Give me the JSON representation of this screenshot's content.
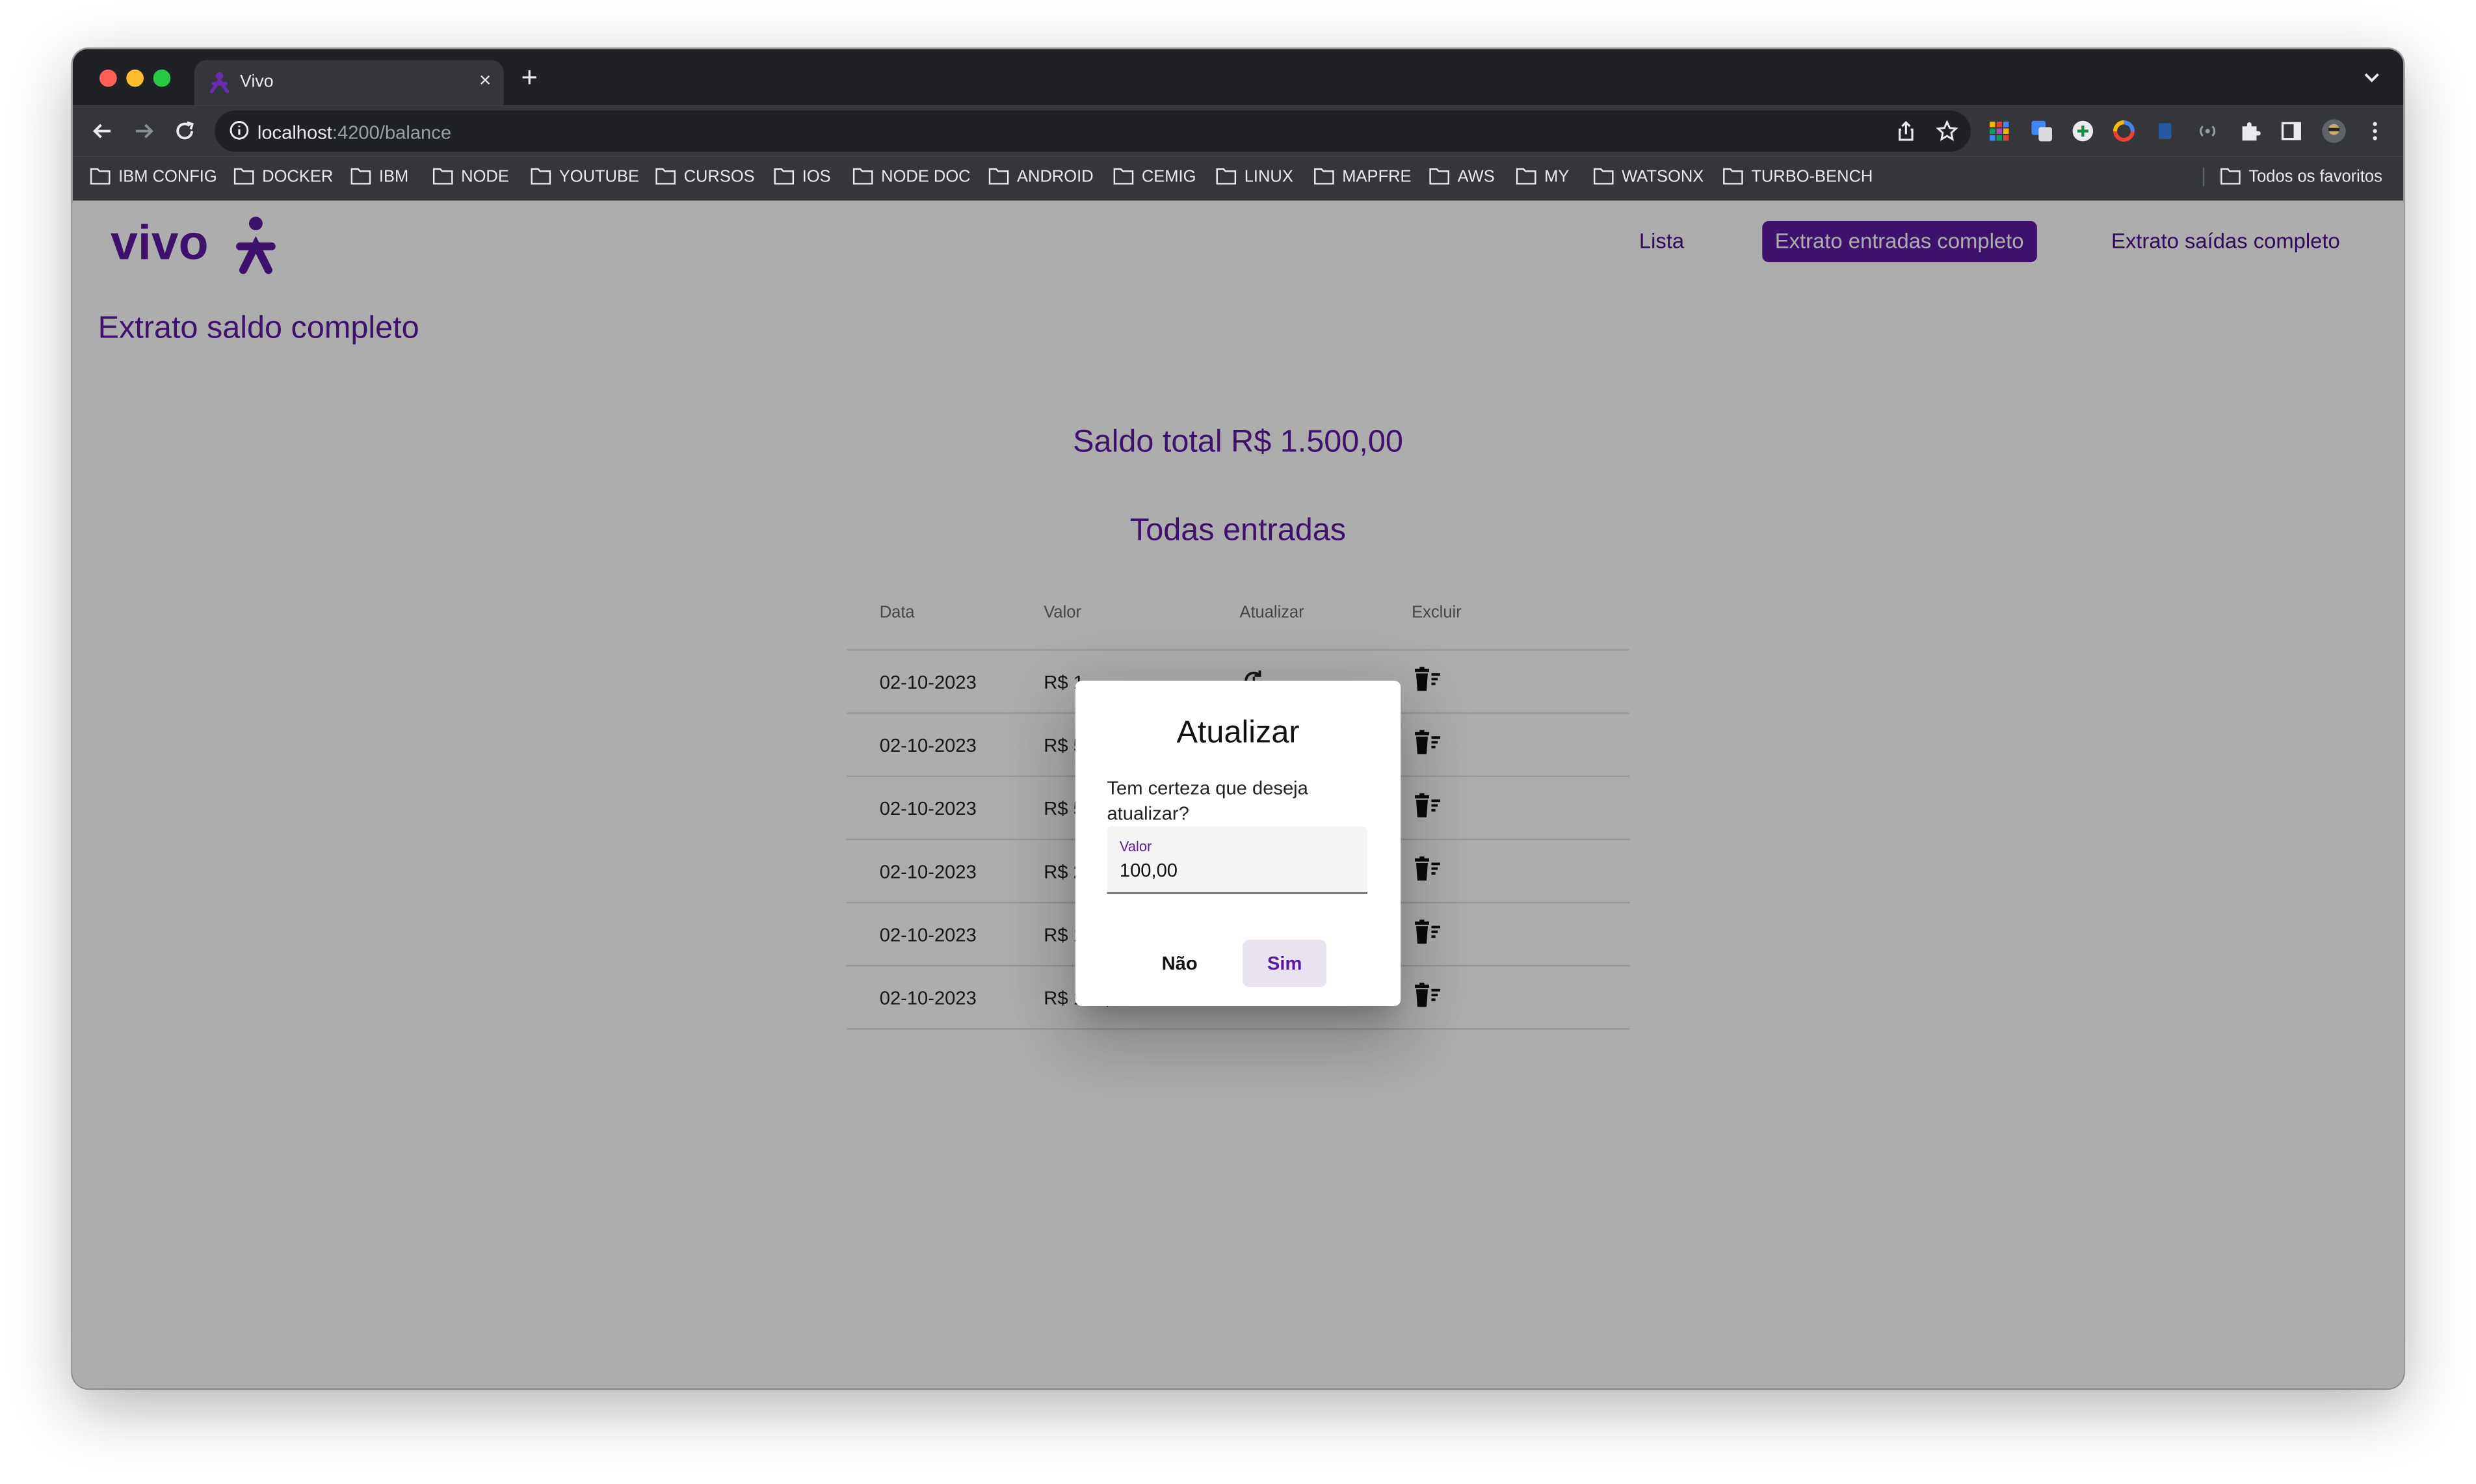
{
  "browser": {
    "tab_title": "Vivo",
    "tab_close": "×",
    "new_tab": "+",
    "url_host": "localhost",
    "url_path": ":4200/balance",
    "bookmarks": [
      "IBM CONFIG",
      "DOCKER",
      "IBM",
      "NODE",
      "YOUTUBE",
      "CURSOS",
      "IOS",
      "NODE DOC",
      "ANDROID",
      "CEMIG",
      "LINUX",
      "MAPFRE",
      "AWS",
      "MY",
      "WATSONX",
      "TURBO-BENCH"
    ],
    "all_bookmarks": "Todos os favoritos"
  },
  "app": {
    "logo_text": "vivo",
    "brand_color": "#5a1aa0",
    "nav": {
      "lista": "Lista",
      "extrato_entradas": "Extrato entradas completo",
      "extrato_saidas": "Extrato saídas completo"
    },
    "page_title": "Extrato saldo completo",
    "saldo_total": "Saldo total R$ 1.500,00",
    "section_title": "Todas entradas",
    "table": {
      "headers": {
        "data": "Data",
        "valor": "Valor",
        "atualizar": "Atualizar",
        "excluir": "Excluir"
      },
      "rows": [
        {
          "data": "02-10-2023",
          "valor": "R$ 1"
        },
        {
          "data": "02-10-2023",
          "valor": "R$ 5"
        },
        {
          "data": "02-10-2023",
          "valor": "R$ 5"
        },
        {
          "data": "02-10-2023",
          "valor": "R$ 2"
        },
        {
          "data": "02-10-2023",
          "valor": "R$ 1"
        },
        {
          "data": "02-10-2023",
          "valor": "R$ 100,00"
        }
      ]
    }
  },
  "dialog": {
    "title": "Atualizar",
    "message": "Tem certeza que deseja atualizar?",
    "field_label": "Valor",
    "field_value": "100,00",
    "cancel_label": "Não",
    "confirm_label": "Sim"
  }
}
